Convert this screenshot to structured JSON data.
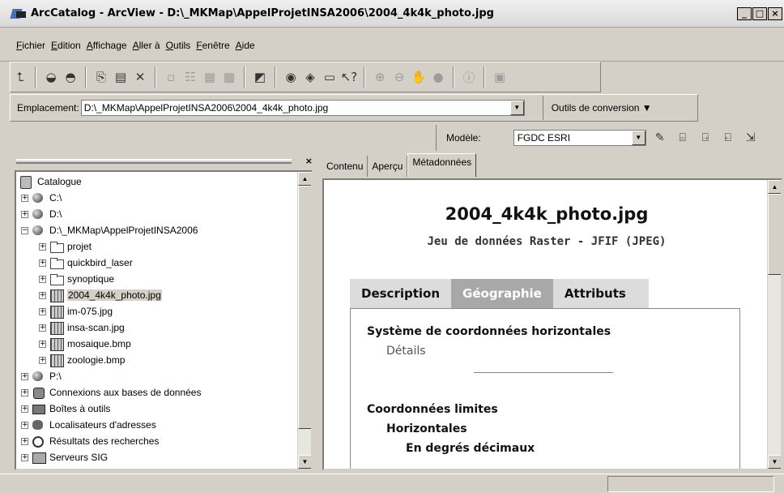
{
  "window": {
    "title": "ArcCatalog - ArcView - D:\\_MKMap\\AppelProjetINSA2006\\2004_4k4k_photo.jpg",
    "buttons": [
      "_",
      "□",
      "×"
    ]
  },
  "menu": [
    "Fichier",
    "Edition",
    "Affichage",
    "Aller à",
    "Outils",
    "Fenêtre",
    "Aide"
  ],
  "toolbar": {
    "icons": [
      "up-one-level-icon",
      "connect-folder-icon",
      "disconnect-folder-icon",
      "copy-icon",
      "paste-icon",
      "delete-icon",
      "large-icons-icon",
      "list-icon",
      "details-icon",
      "thumbnails-icon",
      "launch-arcmap-icon",
      "search-icon",
      "arctoolbox-icon",
      "command-line-icon",
      "whats-this-icon",
      "zoom-in-icon",
      "zoom-out-icon",
      "pan-icon",
      "full-extent-icon",
      "identify-icon",
      "create-thumbnail-icon"
    ]
  },
  "location": {
    "label": "Emplacement:",
    "value": "D:\\_MKMap\\AppelProjetINSA2006\\2004_4k4k_photo.jpg",
    "conversion_button": "Outils de conversion ▼"
  },
  "metadata_bar": {
    "model_label": "Modèle:",
    "model_value": "FGDC ESRI"
  },
  "tree": {
    "items": [
      {
        "label": "Catalogue",
        "icon": "catalog"
      },
      {
        "label": "C:\\",
        "icon": "drive"
      },
      {
        "label": "D:\\",
        "icon": "drive"
      },
      {
        "label": "D:\\_MKMap\\AppelProjetINSA2006",
        "icon": "drive"
      },
      {
        "label": "projet",
        "icon": "folder"
      },
      {
        "label": "quickbird_laser",
        "icon": "folder"
      },
      {
        "label": "synoptique",
        "icon": "folder"
      },
      {
        "label": "2004_4k4k_photo.jpg",
        "icon": "raster"
      },
      {
        "label": "im-075.jpg",
        "icon": "raster"
      },
      {
        "label": "insa-scan.jpg",
        "icon": "raster"
      },
      {
        "label": "mosaique.bmp",
        "icon": "raster"
      },
      {
        "label": "zoologie.bmp",
        "icon": "raster"
      },
      {
        "label": "P:\\",
        "icon": "drive"
      },
      {
        "label": "Connexions aux bases de données",
        "icon": "db"
      },
      {
        "label": "Boîtes à outils",
        "icon": "box"
      },
      {
        "label": "Localisateurs d'adresses",
        "icon": "loc"
      },
      {
        "label": "Résultats des recherches",
        "icon": "search"
      },
      {
        "label": "Serveurs SIG",
        "icon": "server"
      }
    ]
  },
  "right_tabs": [
    "Contenu",
    "Aperçu",
    "Métadonnées"
  ],
  "metadata": {
    "title": "2004_4k4k_photo.jpg",
    "subtitle": "Jeu de données Raster - JFIF (JPEG)",
    "tabs": [
      "Description",
      "Géographie",
      "Attributs"
    ],
    "section1": "Système de coordonnées horizontales",
    "details_link": "Détails",
    "section2": "Coordonnées limites",
    "section2_sub": "Horizontales",
    "section2_subsub": "En degrés décimaux"
  }
}
